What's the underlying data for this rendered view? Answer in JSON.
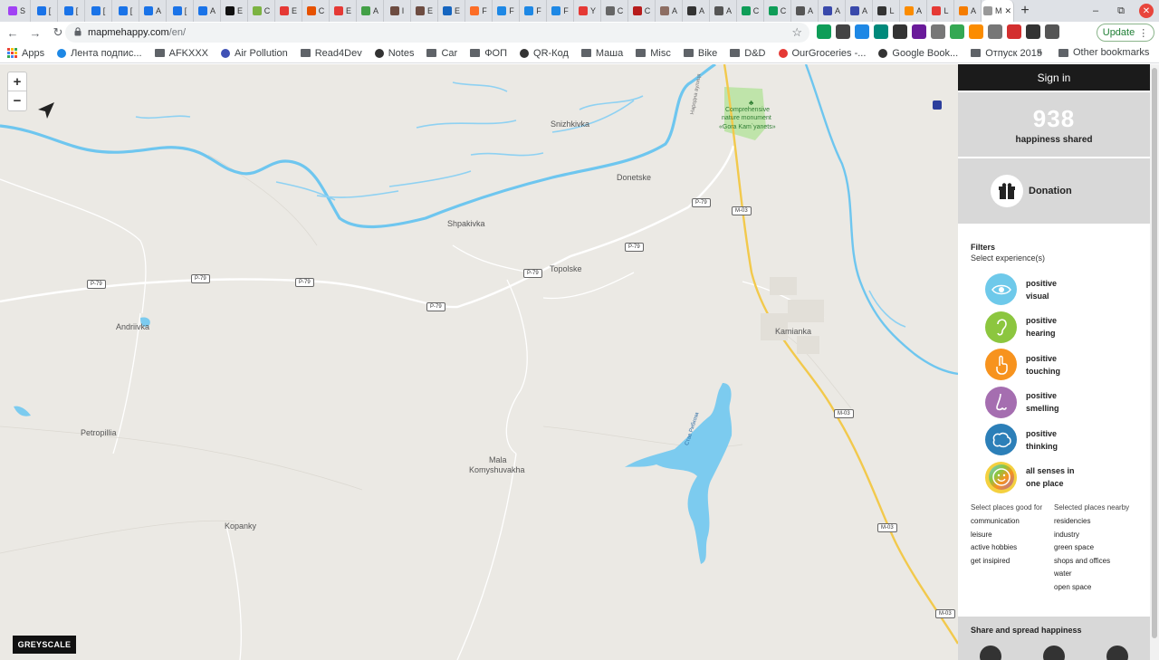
{
  "browser": {
    "tabs": [
      {
        "title": "S",
        "color": "#a142f4"
      },
      {
        "title": "[",
        "color": "#1a73e8"
      },
      {
        "title": "[",
        "color": "#1a73e8"
      },
      {
        "title": "[",
        "color": "#1a73e8"
      },
      {
        "title": "[",
        "color": "#1a73e8"
      },
      {
        "title": "A",
        "color": "#1a73e8"
      },
      {
        "title": "[",
        "color": "#1a73e8"
      },
      {
        "title": "A",
        "color": "#1a73e8"
      },
      {
        "title": "E",
        "color": "#111111"
      },
      {
        "title": "C",
        "color": "#7cb342"
      },
      {
        "title": "E",
        "color": "#e53935"
      },
      {
        "title": "C",
        "color": "#e65100"
      },
      {
        "title": "E",
        "color": "#e53935"
      },
      {
        "title": "A",
        "color": "#43a047"
      },
      {
        "title": "I",
        "color": "#6d4c41"
      },
      {
        "title": "E",
        "color": "#6d4c41"
      },
      {
        "title": "E",
        "color": "#1565c0"
      },
      {
        "title": "F",
        "color": "#fc6d26"
      },
      {
        "title": "F",
        "color": "#1e88e5"
      },
      {
        "title": "F",
        "color": "#1e88e5"
      },
      {
        "title": "F",
        "color": "#1e88e5"
      },
      {
        "title": "Y",
        "color": "#e53935"
      },
      {
        "title": "C",
        "color": "#666666"
      },
      {
        "title": "C",
        "color": "#b71c1c"
      },
      {
        "title": "A",
        "color": "#8d6e63"
      },
      {
        "title": "A",
        "color": "#333333"
      },
      {
        "title": "A",
        "color": "#555555"
      },
      {
        "title": "C",
        "color": "#0f9d58"
      },
      {
        "title": "C",
        "color": "#0f9d58"
      },
      {
        "title": "A",
        "color": "#555555"
      },
      {
        "title": "A",
        "color": "#3949ab"
      },
      {
        "title": "A",
        "color": "#3949ab"
      },
      {
        "title": "L",
        "color": "#333333"
      },
      {
        "title": "A",
        "color": "#fb8c00"
      },
      {
        "title": "L",
        "color": "#e53935"
      },
      {
        "title": "A",
        "color": "#f57c00"
      }
    ],
    "active_tab": {
      "title": "M",
      "color": "#999999"
    },
    "new_tab": "+",
    "window_buttons": {
      "minimize": "–",
      "restore": "⧉",
      "close": "✕"
    },
    "url": {
      "host": "mapmehappy.com",
      "path": "/en/"
    },
    "update_label": "Update",
    "extensions": [
      "#0f9d58",
      "#444444",
      "#1e88e5",
      "#00897b",
      "#333333",
      "#6a1b9a",
      "#777777",
      "#34a853",
      "#fb8c00",
      "#777777",
      "#d32f2f",
      "#333333",
      "#555555"
    ],
    "bookmarks": [
      {
        "label": "Apps",
        "type": "apps"
      },
      {
        "label": "Лента подпис...",
        "type": "site",
        "color": "#1e88e5"
      },
      {
        "label": "AFKXXX",
        "type": "folder"
      },
      {
        "label": "Air Pollution",
        "type": "site",
        "color": "#3f51b5"
      },
      {
        "label": "Read4Dev",
        "type": "folder"
      },
      {
        "label": "Notes",
        "type": "site",
        "color": "#333333"
      },
      {
        "label": "Car",
        "type": "folder"
      },
      {
        "label": "ФОП",
        "type": "folder"
      },
      {
        "label": "QR-Код",
        "type": "site",
        "color": "#333333"
      },
      {
        "label": "Маша",
        "type": "folder"
      },
      {
        "label": "Misc",
        "type": "folder"
      },
      {
        "label": "Bike",
        "type": "folder"
      },
      {
        "label": "D&D",
        "type": "folder"
      },
      {
        "label": "OurGroceries -...",
        "type": "site",
        "color": "#e53935"
      },
      {
        "label": "Google Book...",
        "type": "site",
        "color": "#333333"
      },
      {
        "label": "Отпуск 2015",
        "type": "folder"
      }
    ],
    "bookmarks_more": "»",
    "other_bookmarks": "Other bookmarks"
  },
  "map": {
    "zoom_in": "+",
    "zoom_out": "−",
    "greyscale_label": "GREYSCALE",
    "colors": {
      "land": "#ebe9e4",
      "water": "#7ccbef",
      "river": "#6ec6ef",
      "road_major": "#f2c94c",
      "park": "#b7e3a0"
    },
    "places": [
      {
        "name": "Snizhkivka"
      },
      {
        "name": "Donetske"
      },
      {
        "name": "Shpakivka"
      },
      {
        "name": "Topolske"
      },
      {
        "name": "Andriivka"
      },
      {
        "name": "Kamianka"
      },
      {
        "name": "Petropillia"
      },
      {
        "name": "Mala"
      },
      {
        "name": "Komyshuvakha"
      },
      {
        "name": "Kopanky"
      },
      {
        "name": "Comprehensive"
      },
      {
        "name": "nature monument"
      },
      {
        "name": "«Gora Kam`yanets»"
      },
      {
        "name": "Став Рибхоза"
      },
      {
        "name": "Народна вулиця"
      }
    ],
    "road_labels": [
      "P-79",
      "P-79",
      "P-79",
      "P-79",
      "P-79",
      "P-79",
      "P-79",
      "M-03",
      "M-03",
      "M-03",
      "M-03"
    ]
  },
  "panel": {
    "sign_in": "Sign in",
    "counter": {
      "value": "938",
      "label": "happiness shared"
    },
    "donation": "Donation",
    "filters_title": "Filters",
    "filters_subtitle": "Select experience(s)",
    "senses": [
      {
        "label": "positive visual",
        "color": "#6ec9ea",
        "icon": "eye-icon"
      },
      {
        "label": "positive hearing",
        "color": "#8cc63f",
        "icon": "ear-icon"
      },
      {
        "label": "positive touching",
        "color": "#f7931e",
        "icon": "hand-icon"
      },
      {
        "label": "positive smelling",
        "color": "#a56eb0",
        "icon": "nose-icon"
      },
      {
        "label": "positive thinking",
        "color": "#2c7fb8",
        "icon": "brain-icon"
      },
      {
        "label": "all senses in one place",
        "color": "#f4d03f",
        "icon": "smiley-icon"
      }
    ],
    "good_for_title": "Select places good for",
    "good_for": [
      "communication",
      "leisure",
      "active hobbies",
      "get insipired"
    ],
    "nearby_title": "Selected places nearby",
    "nearby": [
      "residencies",
      "industry",
      "green space",
      "shops and offices",
      "water",
      "open space"
    ],
    "share_title": "Share and spread happiness",
    "share_icons": [
      "facebook-icon",
      "mail-icon",
      "twitter-icon"
    ]
  }
}
